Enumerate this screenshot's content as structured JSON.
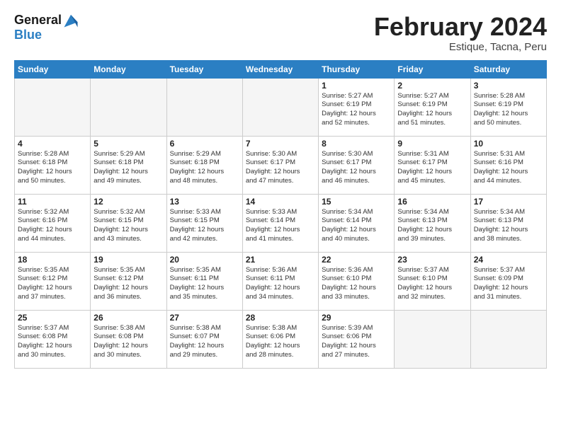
{
  "logo": {
    "line1": "General",
    "line2": "Blue"
  },
  "title": "February 2024",
  "location": "Estique, Tacna, Peru",
  "header": {
    "days": [
      "Sunday",
      "Monday",
      "Tuesday",
      "Wednesday",
      "Thursday",
      "Friday",
      "Saturday"
    ]
  },
  "weeks": [
    [
      {
        "day": "",
        "info": ""
      },
      {
        "day": "",
        "info": ""
      },
      {
        "day": "",
        "info": ""
      },
      {
        "day": "",
        "info": ""
      },
      {
        "day": "1",
        "info": "Sunrise: 5:27 AM\nSunset: 6:19 PM\nDaylight: 12 hours\nand 52 minutes."
      },
      {
        "day": "2",
        "info": "Sunrise: 5:27 AM\nSunset: 6:19 PM\nDaylight: 12 hours\nand 51 minutes."
      },
      {
        "day": "3",
        "info": "Sunrise: 5:28 AM\nSunset: 6:19 PM\nDaylight: 12 hours\nand 50 minutes."
      }
    ],
    [
      {
        "day": "4",
        "info": "Sunrise: 5:28 AM\nSunset: 6:18 PM\nDaylight: 12 hours\nand 50 minutes."
      },
      {
        "day": "5",
        "info": "Sunrise: 5:29 AM\nSunset: 6:18 PM\nDaylight: 12 hours\nand 49 minutes."
      },
      {
        "day": "6",
        "info": "Sunrise: 5:29 AM\nSunset: 6:18 PM\nDaylight: 12 hours\nand 48 minutes."
      },
      {
        "day": "7",
        "info": "Sunrise: 5:30 AM\nSunset: 6:17 PM\nDaylight: 12 hours\nand 47 minutes."
      },
      {
        "day": "8",
        "info": "Sunrise: 5:30 AM\nSunset: 6:17 PM\nDaylight: 12 hours\nand 46 minutes."
      },
      {
        "day": "9",
        "info": "Sunrise: 5:31 AM\nSunset: 6:17 PM\nDaylight: 12 hours\nand 45 minutes."
      },
      {
        "day": "10",
        "info": "Sunrise: 5:31 AM\nSunset: 6:16 PM\nDaylight: 12 hours\nand 44 minutes."
      }
    ],
    [
      {
        "day": "11",
        "info": "Sunrise: 5:32 AM\nSunset: 6:16 PM\nDaylight: 12 hours\nand 44 minutes."
      },
      {
        "day": "12",
        "info": "Sunrise: 5:32 AM\nSunset: 6:15 PM\nDaylight: 12 hours\nand 43 minutes."
      },
      {
        "day": "13",
        "info": "Sunrise: 5:33 AM\nSunset: 6:15 PM\nDaylight: 12 hours\nand 42 minutes."
      },
      {
        "day": "14",
        "info": "Sunrise: 5:33 AM\nSunset: 6:14 PM\nDaylight: 12 hours\nand 41 minutes."
      },
      {
        "day": "15",
        "info": "Sunrise: 5:34 AM\nSunset: 6:14 PM\nDaylight: 12 hours\nand 40 minutes."
      },
      {
        "day": "16",
        "info": "Sunrise: 5:34 AM\nSunset: 6:13 PM\nDaylight: 12 hours\nand 39 minutes."
      },
      {
        "day": "17",
        "info": "Sunrise: 5:34 AM\nSunset: 6:13 PM\nDaylight: 12 hours\nand 38 minutes."
      }
    ],
    [
      {
        "day": "18",
        "info": "Sunrise: 5:35 AM\nSunset: 6:12 PM\nDaylight: 12 hours\nand 37 minutes."
      },
      {
        "day": "19",
        "info": "Sunrise: 5:35 AM\nSunset: 6:12 PM\nDaylight: 12 hours\nand 36 minutes."
      },
      {
        "day": "20",
        "info": "Sunrise: 5:35 AM\nSunset: 6:11 PM\nDaylight: 12 hours\nand 35 minutes."
      },
      {
        "day": "21",
        "info": "Sunrise: 5:36 AM\nSunset: 6:11 PM\nDaylight: 12 hours\nand 34 minutes."
      },
      {
        "day": "22",
        "info": "Sunrise: 5:36 AM\nSunset: 6:10 PM\nDaylight: 12 hours\nand 33 minutes."
      },
      {
        "day": "23",
        "info": "Sunrise: 5:37 AM\nSunset: 6:10 PM\nDaylight: 12 hours\nand 32 minutes."
      },
      {
        "day": "24",
        "info": "Sunrise: 5:37 AM\nSunset: 6:09 PM\nDaylight: 12 hours\nand 31 minutes."
      }
    ],
    [
      {
        "day": "25",
        "info": "Sunrise: 5:37 AM\nSunset: 6:08 PM\nDaylight: 12 hours\nand 30 minutes."
      },
      {
        "day": "26",
        "info": "Sunrise: 5:38 AM\nSunset: 6:08 PM\nDaylight: 12 hours\nand 30 minutes."
      },
      {
        "day": "27",
        "info": "Sunrise: 5:38 AM\nSunset: 6:07 PM\nDaylight: 12 hours\nand 29 minutes."
      },
      {
        "day": "28",
        "info": "Sunrise: 5:38 AM\nSunset: 6:06 PM\nDaylight: 12 hours\nand 28 minutes."
      },
      {
        "day": "29",
        "info": "Sunrise: 5:39 AM\nSunset: 6:06 PM\nDaylight: 12 hours\nand 27 minutes."
      },
      {
        "day": "",
        "info": ""
      },
      {
        "day": "",
        "info": ""
      }
    ]
  ]
}
